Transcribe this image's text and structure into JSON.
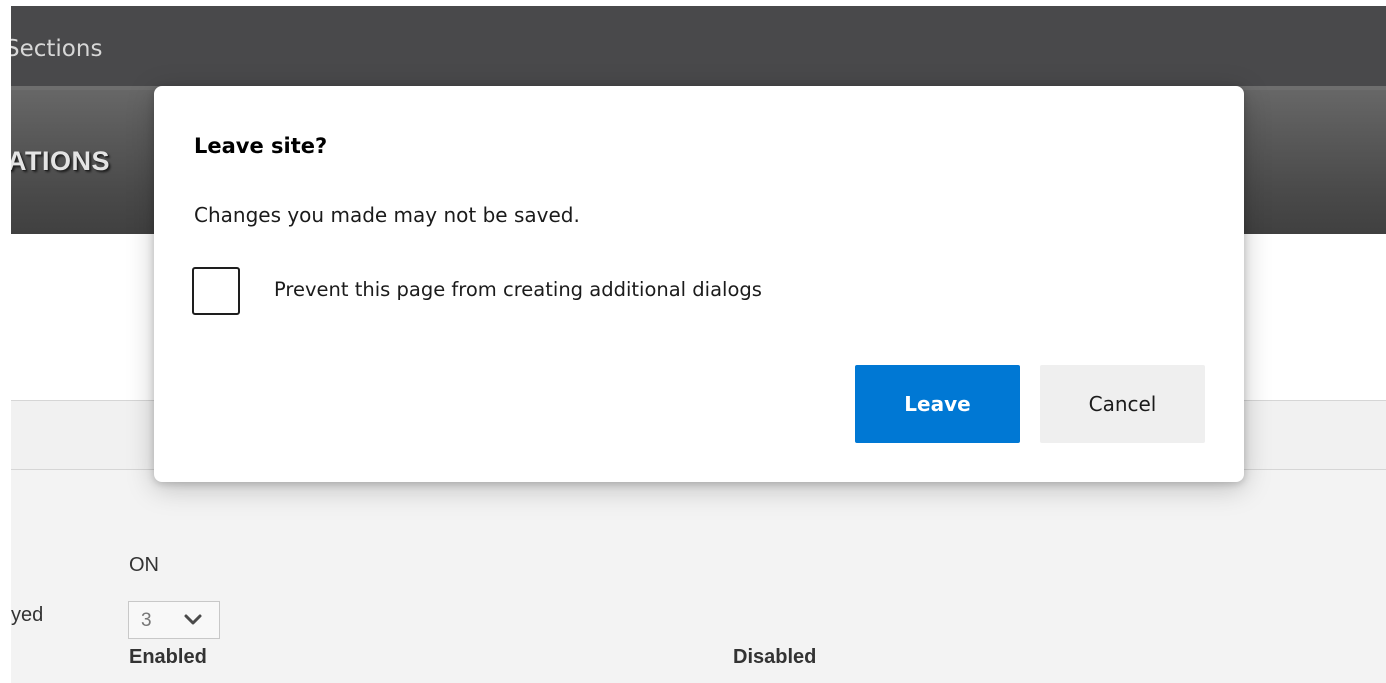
{
  "page": {
    "top_bar_title": "Sections",
    "banner_title": "ATIONS",
    "status_value": "ON",
    "row_label": "yed",
    "count_select_value": "3",
    "columns": [
      "Enabled",
      "Disabled"
    ]
  },
  "dialog": {
    "title": "Leave site?",
    "message": "Changes you made may not be saved.",
    "checkbox_label": "Prevent this page from creating additional dialogs",
    "checkbox_checked": false,
    "primary_button": "Leave",
    "secondary_button": "Cancel"
  },
  "colors": {
    "primary_button_bg": "#0078d4",
    "secondary_button_bg": "#efefef",
    "top_bar_bg": "#49494b",
    "banner_bg": "#555555"
  },
  "icons": {
    "select_arrow": "chevron-down-icon"
  }
}
